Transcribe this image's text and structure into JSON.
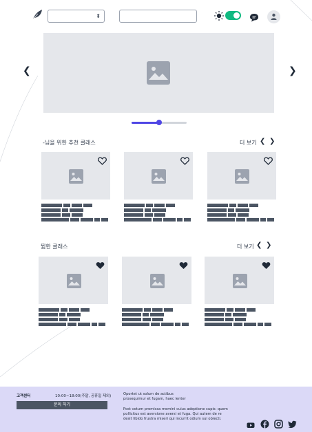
{
  "header": {
    "select_value": "",
    "search_value": "",
    "theme_toggle": "on"
  },
  "sections": [
    {
      "title": "-님을 위한 추천 클래스",
      "more_label": "더 보기",
      "heart_style": "outline"
    },
    {
      "title": "뜀한 클래스",
      "more_label": "더 보기",
      "heart_style": "filled"
    }
  ],
  "footer": {
    "support_label": "고객센터",
    "hours": "10:00~18:00(주말, 공휴일 제외)",
    "inquiry_button": "문의 하기",
    "text_1": "Oportet ut solum de actibus",
    "text_2": "prosequimur et fugam, haec lenter",
    "text_3": "Post votum promissa memini cuius adeptione cupis: quem",
    "text_4": "pollicitus est aversione aversi et fuga. Qui autem de re",
    "text_5": "desit libido frustra miseri qui incurrit odium sui obiecti."
  },
  "colors": {
    "accent": "#4f46e5",
    "toggle_on": "#10b981",
    "placeholder_bar": "#4b5563",
    "footer_bg": "#dbd9f7"
  }
}
